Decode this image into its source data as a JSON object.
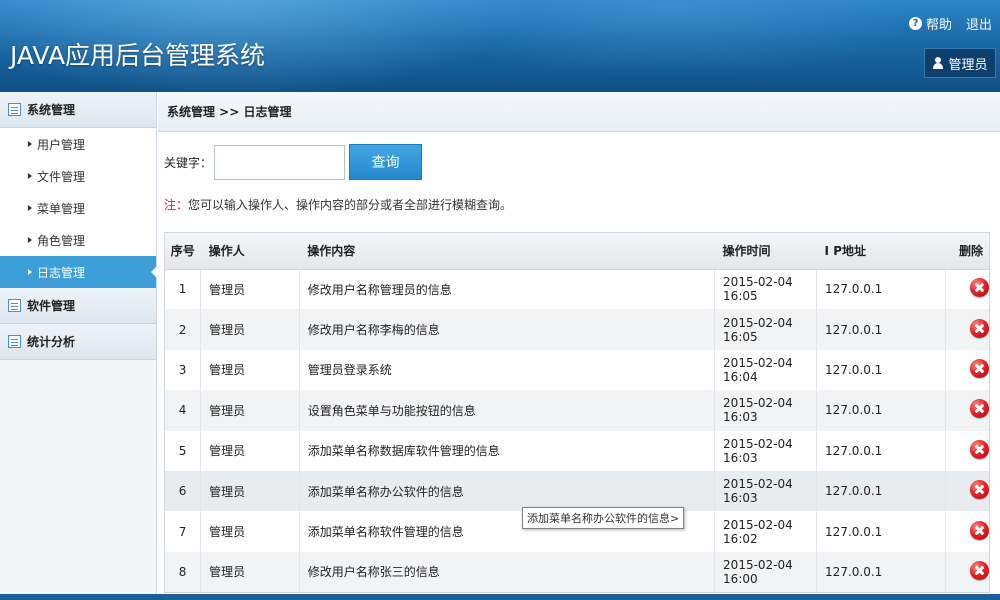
{
  "app": {
    "title": "JAVA应用后台管理系统",
    "help_label": "帮助",
    "logout_label": "退出",
    "user_label": "管理员"
  },
  "sidebar": {
    "groups": [
      {
        "label": "系统管理",
        "items": [
          {
            "label": "用户管理"
          },
          {
            "label": "文件管理"
          },
          {
            "label": "菜单管理"
          },
          {
            "label": "角色管理"
          },
          {
            "label": "日志管理",
            "active": true
          }
        ]
      },
      {
        "label": "软件管理"
      },
      {
        "label": "统计分析"
      }
    ]
  },
  "breadcrumb": "系统管理 >> 日志管理",
  "search": {
    "label": "关键字：",
    "value": "",
    "button_label": "查询"
  },
  "note": {
    "prefix": "注：",
    "text": "您可以输入操作人、操作内容的部分或者全部进行模糊查询。"
  },
  "table": {
    "headers": {
      "no": "序号",
      "operator": "操作人",
      "content": "操作内容",
      "time": "操作时间",
      "ip": "I P地址",
      "delete": "删除"
    },
    "rows": [
      {
        "no": "1",
        "operator": "管理员",
        "content": "修改用户名称管理员的信息",
        "time": "2015-02-04 16:05",
        "ip": "127.0.0.1"
      },
      {
        "no": "2",
        "operator": "管理员",
        "content": "修改用户名称李梅的信息",
        "time": "2015-02-04 16:05",
        "ip": "127.0.0.1"
      },
      {
        "no": "3",
        "operator": "管理员",
        "content": "管理员登录系统",
        "time": "2015-02-04 16:04",
        "ip": "127.0.0.1"
      },
      {
        "no": "4",
        "operator": "管理员",
        "content": "设置角色菜单与功能按钮的信息",
        "time": "2015-02-04 16:03",
        "ip": "127.0.0.1"
      },
      {
        "no": "5",
        "operator": "管理员",
        "content": "添加菜单名称数据库软件管理的信息",
        "time": "2015-02-04 16:03",
        "ip": "127.0.0.1"
      },
      {
        "no": "6",
        "operator": "管理员",
        "content": "添加菜单名称办公软件的信息",
        "time": "2015-02-04 16:03",
        "ip": "127.0.0.1"
      },
      {
        "no": "7",
        "operator": "管理员",
        "content": "添加菜单名称软件管理的信息",
        "time": "2015-02-04 16:02",
        "ip": "127.0.0.1"
      },
      {
        "no": "8",
        "operator": "管理员",
        "content": "修改用户名称张三的信息",
        "time": "2015-02-04 16:00",
        "ip": "127.0.0.1"
      }
    ]
  },
  "tooltip": "添加菜单名称办公软件的信息>",
  "colors": {
    "header_bg": "#1a6aa8",
    "active_menu": "#3d9fd9",
    "button": "#2389cc",
    "note_red": "#e02020",
    "delete_icon": "#e3242b"
  }
}
